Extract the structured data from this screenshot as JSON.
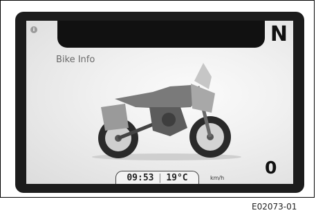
{
  "screen": {
    "title": "Bike Info",
    "gear": "N",
    "info_icon": "i",
    "status": {
      "time": "09:53",
      "separator": "|",
      "temperature": "19°C"
    },
    "speed_unit": "km/h",
    "speed": "0"
  },
  "figure_code": "E02073-01"
}
